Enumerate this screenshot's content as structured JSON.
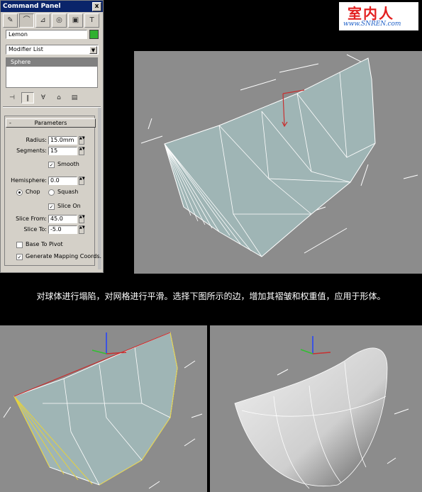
{
  "panel": {
    "title": "Command Panel",
    "close_glyph": "x",
    "tabs": [
      "create-icon",
      "modify-icon",
      "hierarchy-icon",
      "motion-icon",
      "display-icon",
      "utilities-icon"
    ],
    "object_name": "Lemon",
    "object_color": "#2fb02f",
    "modifier_list": "Modifier List",
    "stack_item": "Sphere",
    "rollout_title": "Parameters",
    "radius_label": "Radius:",
    "radius_value": "15.0mm",
    "segments_label": "Segments:",
    "segments_value": "15",
    "smooth_label": "Smooth",
    "smooth_checked": true,
    "hemisphere_label": "Hemisphere:",
    "hemisphere_value": "0.0",
    "chop_label": "Chop",
    "squash_label": "Squash",
    "slice_on_label": "Slice On",
    "slice_on_checked": true,
    "slice_from_label": "Slice From:",
    "slice_from_value": "45.0",
    "slice_to_label": "Slice To:",
    "slice_to_value": "-5.0",
    "base_to_pivot_label": "Base To Pivot",
    "gen_mapping_label": "Generate Mapping Coords.",
    "check_glyph": "✓"
  },
  "logo": {
    "name": "室内人",
    "url": "www.SNREN.com"
  },
  "caption": "对球体进行塌陷，对网格进行平滑。选择下图所示的边，增加其褶皱和权重值，应用于形体。",
  "colors": {
    "viewport_bg": "#8c8c8c",
    "mesh_fill": "#9fb5b5",
    "wire": "#ffffff",
    "selected_edge": "#c83030",
    "yellow_wire": "#e6d23c"
  }
}
